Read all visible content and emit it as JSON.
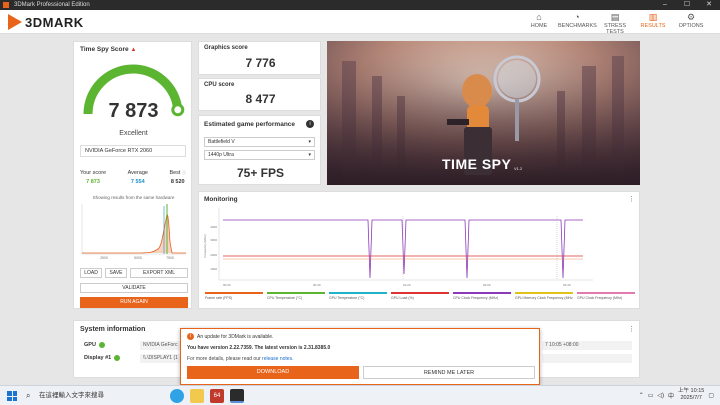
{
  "window": {
    "title": "3DMark Professional Edition",
    "min": "–",
    "max": "☐",
    "close": "✕"
  },
  "app": {
    "logo_text": "3DMARK"
  },
  "nav": [
    {
      "label": "HOME",
      "icon": "⌂",
      "icon_name": "home-icon"
    },
    {
      "label": "BENCHMARKS",
      "icon": "◔",
      "icon_name": "gauge-icon"
    },
    {
      "label": "STRESS TESTS",
      "icon": "▤",
      "icon_name": "stress-icon"
    },
    {
      "label": "RESULTS",
      "icon": "▥",
      "icon_name": "results-icon"
    },
    {
      "label": "OPTIONS",
      "icon": "⚙",
      "icon_name": "gear-icon"
    }
  ],
  "active_nav": "RESULTS",
  "score_card": {
    "title": "Time Spy Score",
    "warning_icon": "▲",
    "score": "7 873",
    "verdict": "Excellent",
    "gpu": "NVIDIA GeForce RTX 2060",
    "your_score_label": "Your score",
    "your_score": "7 873",
    "average_label": "Average",
    "average": "7 554",
    "best_label": "Best",
    "best": "8 520",
    "hist_note": "Showing results from the same hardware",
    "hist_x_ticks": [
      "2500",
      "5000",
      "7500"
    ],
    "gauge_fraction": 0.97
  },
  "buttons": {
    "load": "LOAD",
    "save": "SAVE",
    "export": "EXPORT XML",
    "validate": "VALIDATE",
    "run_again": "RUN AGAIN"
  },
  "graphics": {
    "label": "Graphics score",
    "value": "7 776"
  },
  "cpu": {
    "label": "CPU score",
    "value": "8 477"
  },
  "perf": {
    "title": "Estimated game performance",
    "info": "i",
    "game": "Battlefield V",
    "res": "1440p Ultra",
    "fps": "75+ FPS"
  },
  "hero": {
    "title": "TIME SPY",
    "version": "V1.2"
  },
  "monitoring": {
    "title": "Monitoring",
    "more": "⋮",
    "y_ticks": [
      "4000",
      "3000",
      "2000",
      "1000"
    ],
    "x_ticks": [
      "00:00",
      "00:40",
      "01:20",
      "02:00",
      "02:40"
    ],
    "legend": [
      {
        "label": "Frame rate (FPS)",
        "color": "#e8641b"
      },
      {
        "label": "CPU Temperature (°C)",
        "color": "#5cb531"
      },
      {
        "label": "GPU Temperature (°C)",
        "color": "#1fb3c9"
      },
      {
        "label": "GPU Load (%)",
        "color": "#d33"
      },
      {
        "label": "CPU Clock Frequency (MHz)",
        "color": "#8a3ab9"
      },
      {
        "label": "GPU Memory Clock Frequency (MHz)",
        "color": "#e0c21a"
      },
      {
        "label": "GPU Clock Frequency (MHz)",
        "color": "#e07ab0"
      }
    ]
  },
  "system": {
    "title": "System information",
    "more": "⋮",
    "gpu_label": "GPU",
    "gpu_value": "NVIDIA GeForc",
    "display_label": "Display #1",
    "display_value": "\\\\.\\DISPLAY1 (1",
    "time_value": "7 10:05 +08:00"
  },
  "update": {
    "title": "An update for 3DMark is available.",
    "version_line": "You have version 2.22.7359. The latest version is 2.31.8385.0",
    "more_info": "For more details, please read our",
    "link": "release notes.",
    "download": "DOWNLOAD",
    "remind": "REMIND ME LATER"
  },
  "taskbar": {
    "search": "在這裡輸入文字來搜尋",
    "ime": "中",
    "time": "上午 10:15",
    "date": "2025/7/7"
  },
  "colors": {
    "accent": "#e8641b",
    "gauge": "#5cb531"
  }
}
